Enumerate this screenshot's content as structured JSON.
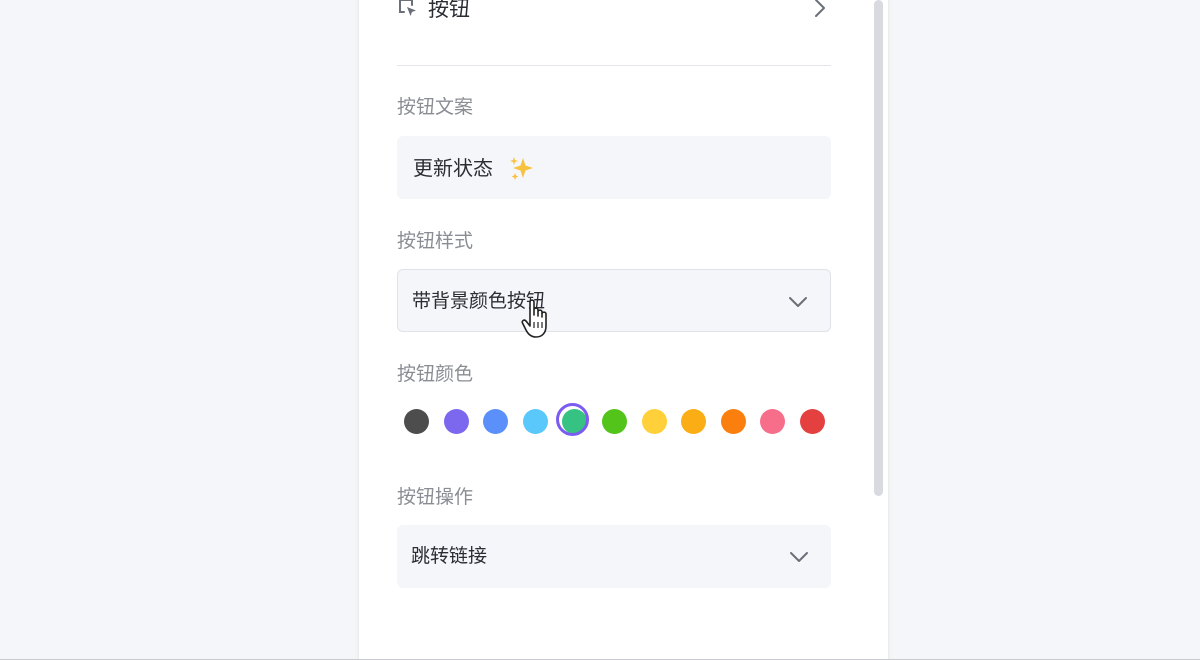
{
  "header": {
    "title": "按钮",
    "icon": "cursor-click-icon",
    "chevron": "chevron-right-icon"
  },
  "fields": {
    "text_label": "按钮文案",
    "text_value": "更新状态",
    "text_emoji": "sparkles-icon",
    "style_label": "按钮样式",
    "style_value": "带背景颜色按钮",
    "color_label": "按钮颜色",
    "action_label": "按钮操作",
    "action_value": "跳转链接"
  },
  "colors": {
    "options": [
      "#4d4d4d",
      "#7b68ee",
      "#5b8ff9",
      "#5ac8fa",
      "#36c282",
      "#52c41a",
      "#ffd03a",
      "#faad14",
      "#fa7f0f",
      "#f76e8a",
      "#e54040"
    ],
    "selected_index": 4,
    "selected_ring": "#7a5cf0"
  }
}
